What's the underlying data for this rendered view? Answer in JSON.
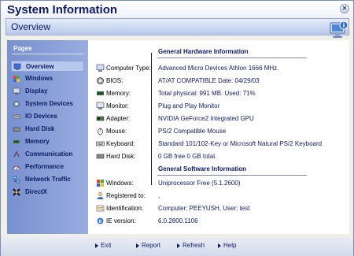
{
  "window": {
    "title": "System Information",
    "close_icon": "close-icon"
  },
  "header": {
    "title": "Overview",
    "icon": "computer-info-icon"
  },
  "sidebar": {
    "label": "Pages",
    "items": [
      {
        "label": "Overview",
        "icon": "overview-icon",
        "selected": true
      },
      {
        "label": "Windows",
        "icon": "windows-icon",
        "selected": false
      },
      {
        "label": "Display",
        "icon": "display-icon",
        "selected": false
      },
      {
        "label": "System Devices",
        "icon": "system-devices-icon",
        "selected": false
      },
      {
        "label": "IO Devices",
        "icon": "io-devices-icon",
        "selected": false
      },
      {
        "label": "Hard Disk",
        "icon": "hard-disk-icon",
        "selected": false
      },
      {
        "label": "Memory",
        "icon": "memory-icon",
        "selected": false
      },
      {
        "label": "Communication",
        "icon": "communication-icon",
        "selected": false
      },
      {
        "label": "Performance",
        "icon": "performance-icon",
        "selected": false
      },
      {
        "label": "Network Traffic",
        "icon": "network-traffic-icon",
        "selected": false
      },
      {
        "label": "DirectX",
        "icon": "directx-icon",
        "selected": false
      }
    ]
  },
  "hardware": {
    "title": "General Hardware Information",
    "rows": [
      {
        "label": "Computer Type:",
        "value": "Advanced Micro Devices Athlon 1666 MHz.",
        "icon": "computer-icon"
      },
      {
        "label": "BIOS:",
        "value": "AT/AT COMPATIBLE Date: 04/29/03",
        "icon": "bios-icon"
      },
      {
        "label": "Memory:",
        "value": "Total physical: 991 MB. Used: 71%",
        "icon": "memory-icon"
      },
      {
        "label": "Monitor:",
        "value": "Plug and Play Monitor",
        "icon": "monitor-icon"
      },
      {
        "label": "Adapter:",
        "value": "NVIDIA GeForce2 Integrated GPU",
        "icon": "adapter-icon"
      },
      {
        "label": "Mouse:",
        "value": "PS/2 Compatible Mouse",
        "icon": "mouse-icon"
      },
      {
        "label": "Keyboard:",
        "value": "Standard 101/102-Key or Microsoft Natural PS/2 Keyboard",
        "icon": "keyboard-icon"
      },
      {
        "label": "Hard Disk:",
        "value": "0 GB free 0 GB total.",
        "icon": "hard-disk-icon"
      }
    ]
  },
  "software": {
    "title": "General Software Information",
    "rows": [
      {
        "label": "Windows:",
        "value": "Uniprocessor Free (5.1.2600)",
        "icon": "windows-icon"
      },
      {
        "label": "Registered to:",
        "value": ",",
        "icon": "user-icon"
      },
      {
        "label": "Identification:",
        "value": "Computer: PEEYUSH, User: test",
        "icon": "identification-icon"
      },
      {
        "label": "IE version:",
        "value": "6.0.2800.1106",
        "icon": "ie-icon"
      }
    ]
  },
  "footer": {
    "exit_label": "Exit",
    "report_label": "Report",
    "refresh_label": "Refresh",
    "help_label": "Help"
  }
}
